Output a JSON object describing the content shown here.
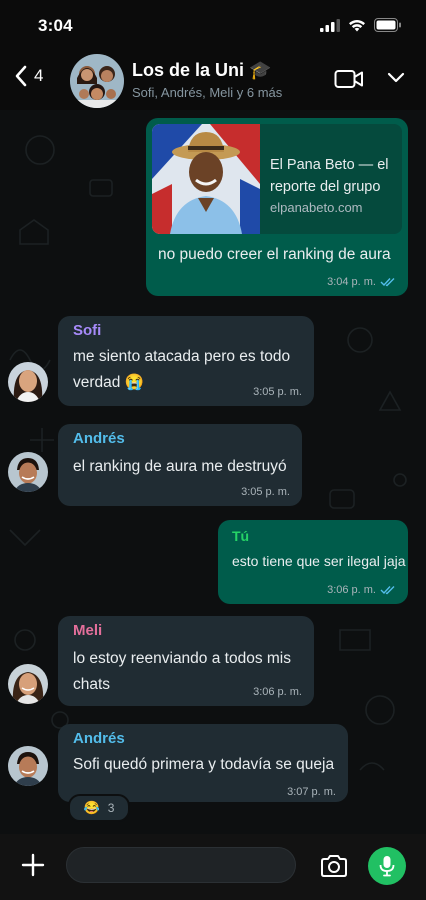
{
  "status_bar": {
    "time": "3:04"
  },
  "header": {
    "back_count": "4",
    "title": "Los de la Uni 🎓",
    "subtitle": "Sofi, Andrés, Meli y 6 más"
  },
  "colors": {
    "outgoing": "#005c4b",
    "incoming": "#202c33",
    "accent": "#21c063",
    "sofi": "#a78bfa",
    "andres": "#53bdeb",
    "meli": "#e36f9b",
    "tu": "#25d366"
  },
  "messages": [
    {
      "direction": "out",
      "link_title": "El Pana Beto — el reporte del grupo",
      "link_domain": "elpanabeto.com",
      "text": "no puedo creer el ranking de aura",
      "time": "3:04 p. m."
    },
    {
      "direction": "in",
      "sender": "Sofi",
      "text_line1": "me siento atacada pero es todo",
      "text_line2": "verdad 😭",
      "time": "3:05 p. m."
    },
    {
      "direction": "in",
      "sender": "Andrés",
      "text": "el ranking de aura me destruyó",
      "time": "3:05 p. m."
    },
    {
      "direction": "out",
      "sender": "Tú",
      "text": "esto tiene que ser ilegal jaja",
      "time": "3:06 p. m."
    },
    {
      "direction": "in",
      "sender": "Meli",
      "text_line1": "lo estoy reenviando a todos mis",
      "text_line2": "chats",
      "time": "3:06 p. m."
    },
    {
      "direction": "in",
      "sender": "Andrés",
      "text": "Sofi quedó primera y todavía se queja",
      "time": "3:07 p. m.",
      "reaction_emoji": "😂",
      "reaction_count": "3"
    }
  ]
}
